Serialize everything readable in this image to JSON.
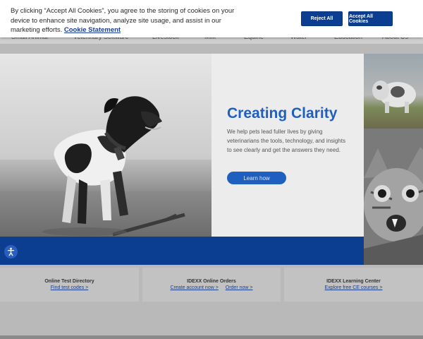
{
  "nav": {
    "items": [
      "Small Animal",
      "Veterinary Software",
      "Livestock",
      "Milk",
      "Equine",
      "Water",
      "Education",
      "About Us"
    ]
  },
  "cookie_banner": {
    "text": "By clicking “Accept All Cookies”, you agree to the storing of cookies on your device to enhance site navigation, analyze site usage, and assist in our marketing efforts.",
    "link_label": "Cookie Statement",
    "reject_label": "Reject All",
    "accept_label": "Accept All Cookies"
  },
  "hero": {
    "title": "Creating Clarity",
    "description": "We help pets lead fuller lives by giving veterinarians the tools, technology, and insights to see clearly and get the answers they need.",
    "button_label": "Learn how"
  },
  "cards": [
    {
      "title": "Online Test Directory",
      "links": [
        "Find test codes >"
      ]
    },
    {
      "title": "IDEXX Online Orders",
      "links": [
        "Create account now >",
        "Order now >"
      ]
    },
    {
      "title": "IDEXX Learning Center",
      "links": [
        "Explore free CE courses >"
      ]
    }
  ],
  "colors": {
    "brand_blue": "#0b3d91",
    "title_blue": "#1f5fbf"
  },
  "icons": {
    "accessibility": "accessibility-icon"
  }
}
